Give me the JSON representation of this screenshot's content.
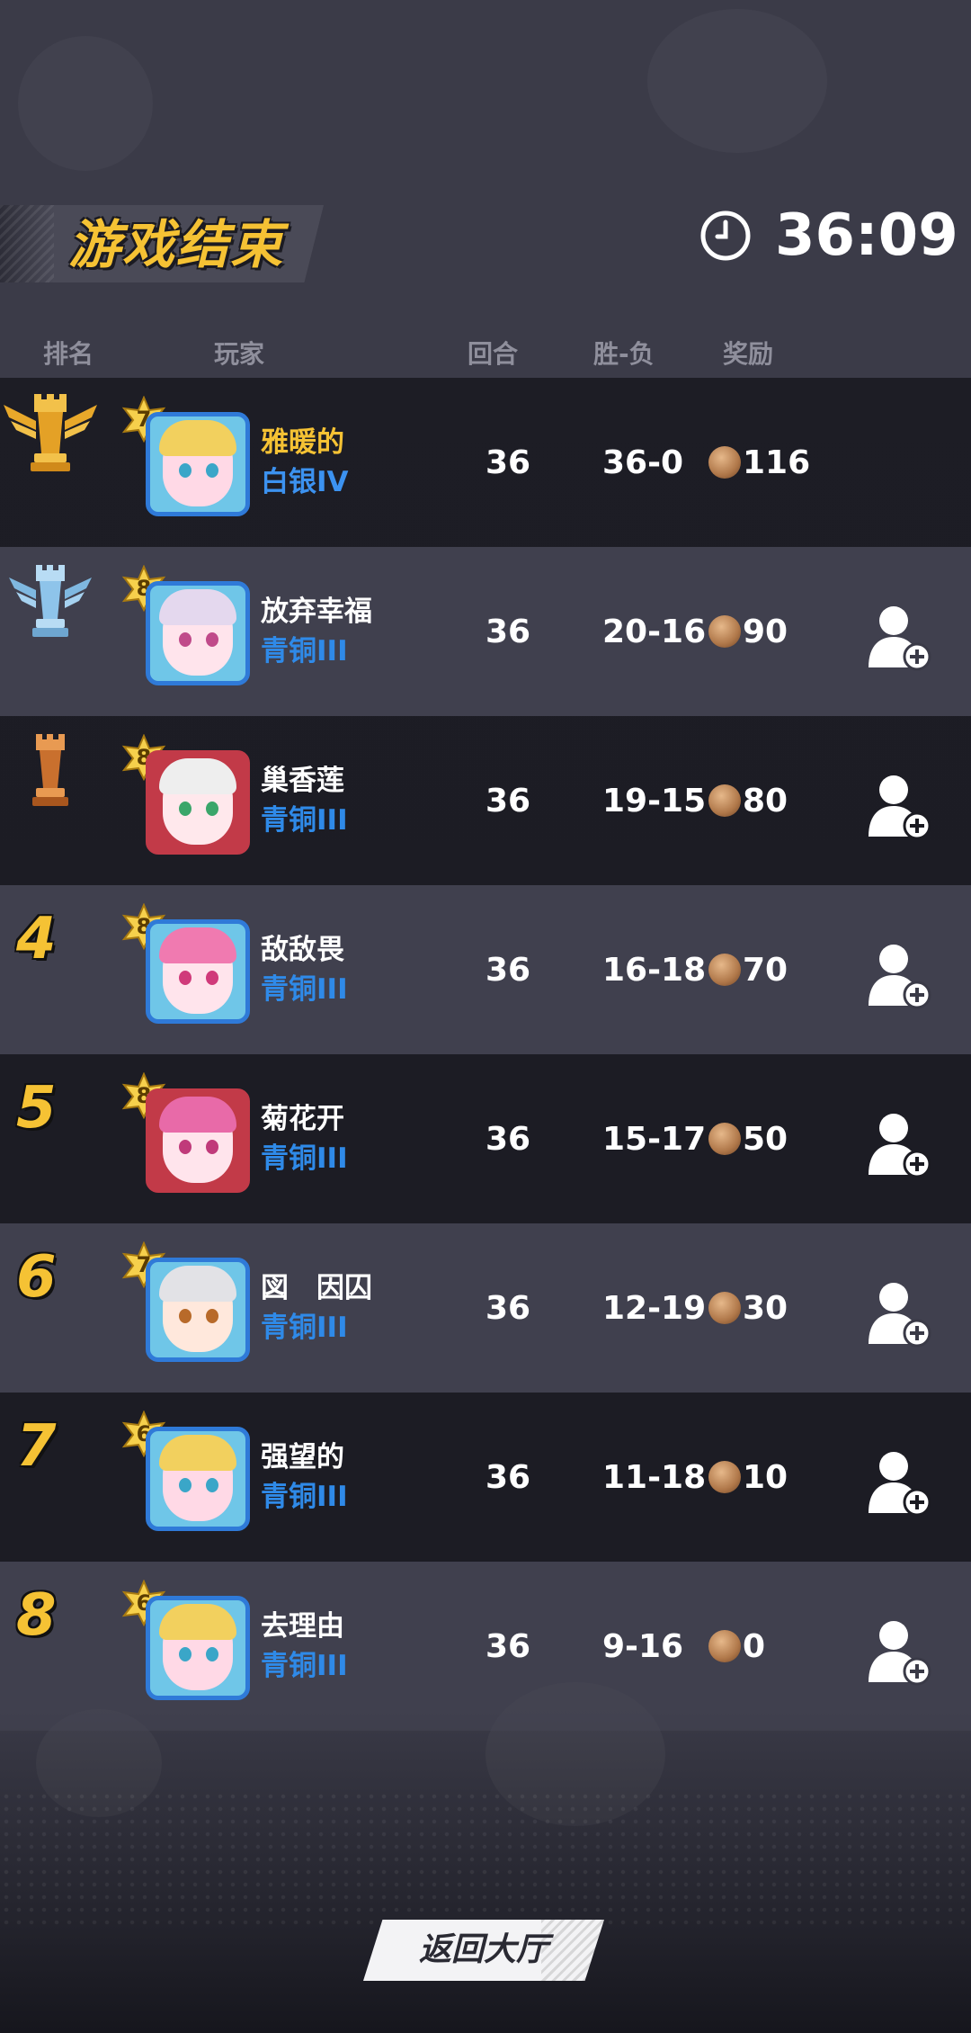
{
  "header": {
    "title": "游戏结束",
    "timer": "36:09",
    "clock_icon": "clock-icon"
  },
  "columns": {
    "rank": "排名",
    "player": "玩家",
    "rounds": "回合",
    "win_loss": "胜-负",
    "reward": "奖励"
  },
  "rows": [
    {
      "rank": "",
      "rank_icon": "gold-rook-trophy-icon",
      "level": "7",
      "name": "雅暖的",
      "tier": "白银IV",
      "rounds": "36",
      "win_loss": "36-0",
      "reward": "116",
      "add_friend": false
    },
    {
      "rank": "",
      "rank_icon": "silver-rook-trophy-icon",
      "level": "8",
      "name": "放弃幸福",
      "tier": "青铜III",
      "rounds": "36",
      "win_loss": "20-16",
      "reward": "90",
      "add_friend": true
    },
    {
      "rank": "",
      "rank_icon": "bronze-rook-trophy-icon",
      "level": "8",
      "name": "巢香莲",
      "tier": "青铜III",
      "rounds": "36",
      "win_loss": "19-15",
      "reward": "80",
      "add_friend": true
    },
    {
      "rank": "4",
      "level": "8",
      "name": "敌敌畏",
      "tier": "青铜III",
      "rounds": "36",
      "win_loss": "16-18",
      "reward": "70",
      "add_friend": true
    },
    {
      "rank": "5",
      "level": "8",
      "name": "菊花开",
      "tier": "青铜III",
      "rounds": "36",
      "win_loss": "15-17",
      "reward": "50",
      "add_friend": true
    },
    {
      "rank": "6",
      "level": "7",
      "name": "図　因囚",
      "tier": "青铜III",
      "rounds": "36",
      "win_loss": "12-19",
      "reward": "30",
      "add_friend": true
    },
    {
      "rank": "7",
      "level": "6",
      "name": "强望的",
      "tier": "青铜III",
      "rounds": "36",
      "win_loss": "11-18",
      "reward": "10",
      "add_friend": true
    },
    {
      "rank": "8",
      "level": "6",
      "name": "去理由",
      "tier": "青铜III",
      "rounds": "36",
      "win_loss": "9-16",
      "reward": "0",
      "add_friend": true
    }
  ],
  "footer": {
    "back_button": "返回大厅"
  },
  "colors": {
    "accent": "#f5c234",
    "tier_blue": "#2f8ae8",
    "row_dark": "#17171e",
    "row_light": "#464654"
  }
}
